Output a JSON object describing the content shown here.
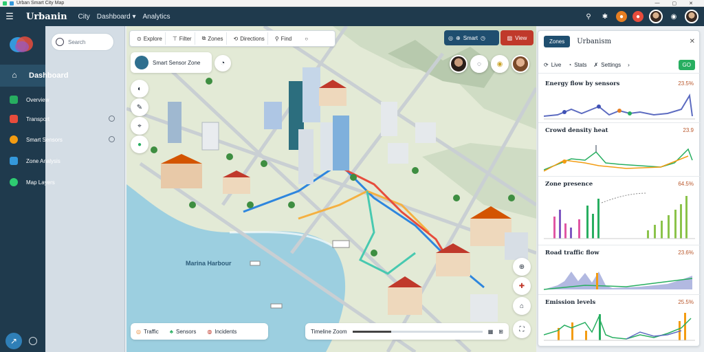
{
  "os": {
    "title": "Urban Smart City Map"
  },
  "app": {
    "title": "Urbanin",
    "nav": [
      "City",
      "Dashboard",
      "Analytics"
    ]
  },
  "nav_panel": {
    "search_placeholder": "Search",
    "active": "Dashboard",
    "items": [
      {
        "label": "Overview",
        "color": "#27ae60"
      },
      {
        "label": "Transport",
        "color": "#e74c3c"
      },
      {
        "label": "Smart Sensors",
        "color": "#f39c12"
      },
      {
        "label": "Zone Analysis",
        "color": "#3498db"
      },
      {
        "label": "Map Layers",
        "color": "#2ecc71"
      }
    ]
  },
  "map": {
    "toolbar": [
      {
        "icon": "target-icon",
        "label": "Explore"
      },
      {
        "icon": "filter-icon",
        "label": "Filter"
      },
      {
        "icon": "layers-icon",
        "label": "Zones"
      },
      {
        "icon": "route-icon",
        "label": "Directions"
      },
      {
        "icon": "search-icon",
        "label": "Find"
      }
    ],
    "mode_label": "Smart",
    "mode2_label": "View",
    "search_card_label": "Smart Sensor Zone",
    "label": "Marina Harbour",
    "bottom_left": [
      "Traffic",
      "Sensors",
      "Incidents"
    ],
    "bottom_right": {
      "label": "Timeline Zoom",
      "progress": 0.3
    }
  },
  "panel": {
    "button": "Zones",
    "title": "Urbanism",
    "tabs": [
      "Live",
      "Stats",
      "Settings"
    ],
    "tab_go": "GO",
    "sections": [
      {
        "title": "Energy flow by sensors",
        "value": "23.5%"
      },
      {
        "title": "Crowd density heat",
        "value": "23.9"
      },
      {
        "title": "Zone presence",
        "value": "64.5%"
      },
      {
        "title": "Road traffic flow",
        "value": "23.6%"
      },
      {
        "title": "Emission levels",
        "value": "25.5%"
      }
    ]
  }
}
